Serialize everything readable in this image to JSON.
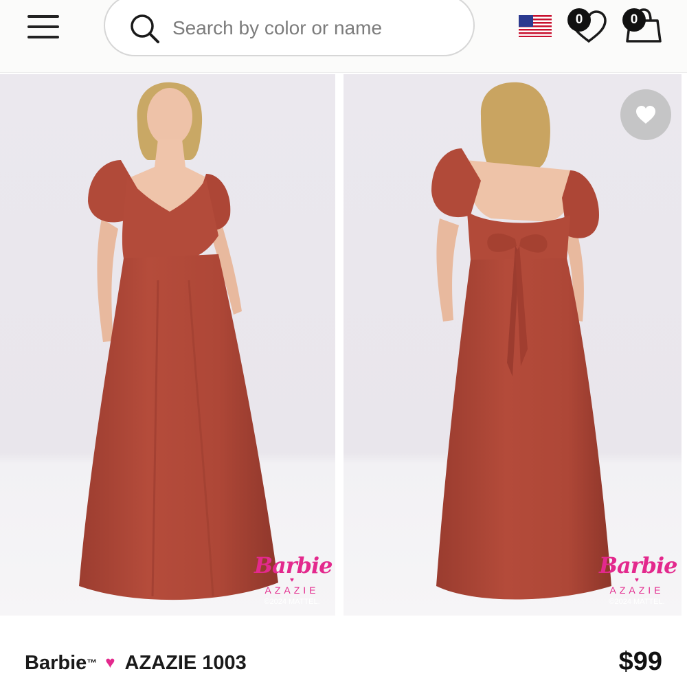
{
  "header": {
    "search": {
      "placeholder": "Search by color or name"
    },
    "wishlist_count": "0",
    "cart_count": "0",
    "region_flag": "us-flag-icon"
  },
  "gallery": {
    "front": {
      "brand_logo": "Barbie",
      "brand_partner": "AZAZIE",
      "copyright": "©2024 MATTEL."
    },
    "back": {
      "brand_logo": "Barbie",
      "brand_partner": "AZAZIE",
      "copyright": "©2024 MATTEL."
    }
  },
  "product": {
    "brand": "Barbie",
    "trademark": "™",
    "name": "AZAZIE 1003",
    "price": "$99"
  },
  "colors": {
    "dress": "#b44a3a",
    "accent_pink": "#e3298d",
    "backdrop": "#ebe8ee"
  }
}
